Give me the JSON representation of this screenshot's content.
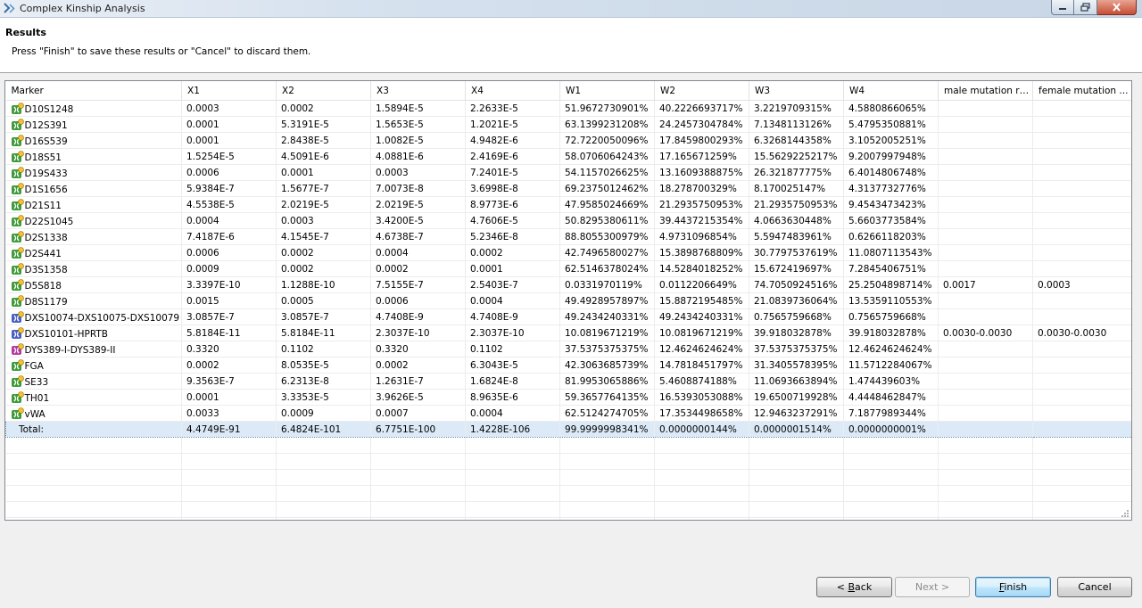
{
  "window": {
    "title": "Complex Kinship Analysis"
  },
  "header": {
    "title": "Results",
    "message": "Press \"Finish\" to save these results or \"Cancel\" to discard them."
  },
  "table": {
    "columns": [
      "Marker",
      "X1",
      "X2",
      "X3",
      "X4",
      "W1",
      "W2",
      "W3",
      "W4",
      "male mutation rate",
      "female mutation ..."
    ],
    "rows": [
      {
        "type": "autosomal",
        "cells": [
          "D10S1248",
          "0.0003",
          "0.0002",
          "1.5894E-5",
          "2.2633E-5",
          "51.9672730901%",
          "40.2226693717%",
          "3.2219709315%",
          "4.5880866065%",
          "",
          ""
        ]
      },
      {
        "type": "autosomal",
        "cells": [
          "D12S391",
          "0.0001",
          "5.3191E-5",
          "1.5653E-5",
          "1.2021E-5",
          "63.1399231208%",
          "24.2457304784%",
          "7.1348113126%",
          "5.4795350881%",
          "",
          ""
        ]
      },
      {
        "type": "autosomal",
        "cells": [
          "D16S539",
          "0.0001",
          "2.8438E-5",
          "1.0082E-5",
          "4.9482E-6",
          "72.7220050096%",
          "17.8459800293%",
          "6.3268144358%",
          "3.1052005251%",
          "",
          ""
        ]
      },
      {
        "type": "autosomal",
        "cells": [
          "D18S51",
          "1.5254E-5",
          "4.5091E-6",
          "4.0881E-6",
          "2.4169E-6",
          "58.0706064243%",
          "17.165671259%",
          "15.5629225217%",
          "9.2007997948%",
          "",
          ""
        ]
      },
      {
        "type": "autosomal",
        "cells": [
          "D19S433",
          "0.0006",
          "0.0001",
          "0.0003",
          "7.2401E-5",
          "54.1157026625%",
          "13.1609388875%",
          "26.321877775%",
          "6.4014806748%",
          "",
          ""
        ]
      },
      {
        "type": "autosomal",
        "cells": [
          "D1S1656",
          "5.9384E-7",
          "1.5677E-7",
          "7.0073E-8",
          "3.6998E-8",
          "69.2375012462%",
          "18.278700329%",
          "8.170025147%",
          "4.3137732776%",
          "",
          ""
        ]
      },
      {
        "type": "autosomal",
        "cells": [
          "D21S11",
          "4.5538E-5",
          "2.0219E-5",
          "2.0219E-5",
          "8.9773E-6",
          "47.9585024669%",
          "21.2935750953%",
          "21.2935750953%",
          "9.4543473423%",
          "",
          ""
        ]
      },
      {
        "type": "autosomal",
        "cells": [
          "D22S1045",
          "0.0004",
          "0.0003",
          "3.4200E-5",
          "4.7606E-5",
          "50.8295380611%",
          "39.4437215354%",
          "4.0663630448%",
          "5.6603773584%",
          "",
          ""
        ]
      },
      {
        "type": "autosomal",
        "cells": [
          "D2S1338",
          "7.4187E-6",
          "4.1545E-7",
          "4.6738E-7",
          "5.2346E-8",
          "88.8055300979%",
          "4.9731096854%",
          "5.5947483961%",
          "0.6266118203%",
          "",
          ""
        ]
      },
      {
        "type": "autosomal",
        "cells": [
          "D2S441",
          "0.0006",
          "0.0002",
          "0.0004",
          "0.0002",
          "42.7496580027%",
          "15.3898768809%",
          "30.7797537619%",
          "11.0807113543%",
          "",
          ""
        ]
      },
      {
        "type": "autosomal",
        "cells": [
          "D3S1358",
          "0.0009",
          "0.0002",
          "0.0002",
          "0.0001",
          "62.5146378024%",
          "14.5284018252%",
          "15.672419697%",
          "7.2845406751%",
          "",
          ""
        ]
      },
      {
        "type": "autosomal",
        "cells": [
          "D5S818",
          "3.3397E-10",
          "1.1288E-10",
          "7.5155E-7",
          "2.5403E-7",
          "0.0331970119%",
          "0.0112206649%",
          "74.7050924516%",
          "25.2504898714%",
          "0.0017",
          "0.0003"
        ]
      },
      {
        "type": "autosomal",
        "cells": [
          "D8S1179",
          "0.0015",
          "0.0005",
          "0.0006",
          "0.0004",
          "49.4928957897%",
          "15.8872195485%",
          "21.0839736064%",
          "13.5359110553%",
          "",
          ""
        ]
      },
      {
        "type": "xlinked",
        "cells": [
          "DXS10074-DXS10075-DXS10079",
          "3.0857E-7",
          "3.0857E-7",
          "4.7408E-9",
          "4.7408E-9",
          "49.2434240331%",
          "49.2434240331%",
          "0.7565759668%",
          "0.7565759668%",
          "",
          ""
        ]
      },
      {
        "type": "xlinked",
        "cells": [
          "DXS10101-HPRTB",
          "5.8184E-11",
          "5.8184E-11",
          "2.3037E-10",
          "2.3037E-10",
          "10.0819671219%",
          "10.0819671219%",
          "39.918032878%",
          "39.918032878%",
          "0.0030-0.0030",
          "0.0030-0.0030"
        ]
      },
      {
        "type": "ylinked",
        "cells": [
          "DYS389-I-DYS389-II",
          "0.3320",
          "0.1102",
          "0.3320",
          "0.1102",
          "37.5375375375%",
          "12.4624624624%",
          "37.5375375375%",
          "12.4624624624%",
          "",
          ""
        ]
      },
      {
        "type": "autosomal",
        "cells": [
          "FGA",
          "0.0002",
          "8.0535E-5",
          "0.0002",
          "6.3043E-5",
          "42.3063685739%",
          "14.7818451797%",
          "31.3405578395%",
          "11.5712284067%",
          "",
          ""
        ]
      },
      {
        "type": "autosomal",
        "cells": [
          "SE33",
          "9.3563E-7",
          "6.2313E-8",
          "1.2631E-7",
          "1.6824E-8",
          "81.9953065886%",
          "5.4608874188%",
          "11.0693663894%",
          "1.474439603%",
          "",
          ""
        ]
      },
      {
        "type": "autosomal",
        "cells": [
          "TH01",
          "0.0001",
          "3.3353E-5",
          "3.9626E-5",
          "8.9635E-6",
          "59.3657764135%",
          "16.5393053088%",
          "19.6500719928%",
          "4.4448462847%",
          "",
          ""
        ]
      },
      {
        "type": "autosomal",
        "cells": [
          "vWA",
          "0.0033",
          "0.0009",
          "0.0007",
          "0.0004",
          "62.5124274705%",
          "17.3534498658%",
          "12.9463237291%",
          "7.1877989344%",
          "",
          ""
        ]
      }
    ],
    "total": [
      "Total:",
      "4.4749E-91",
      "6.4824E-101",
      "6.7751E-100",
      "1.4228E-106",
      "99.9999998341%",
      "0.0000000144%",
      "0.0000001514%",
      "0.0000000001%",
      "",
      ""
    ],
    "empty_rows": 6
  },
  "buttons": {
    "back": "< Back",
    "next": "Next >",
    "finish": "Finish",
    "cancel": "Cancel"
  },
  "colors": {
    "total_row_bg": "#dceaf8",
    "default_button_border": "#3c7fb1"
  }
}
